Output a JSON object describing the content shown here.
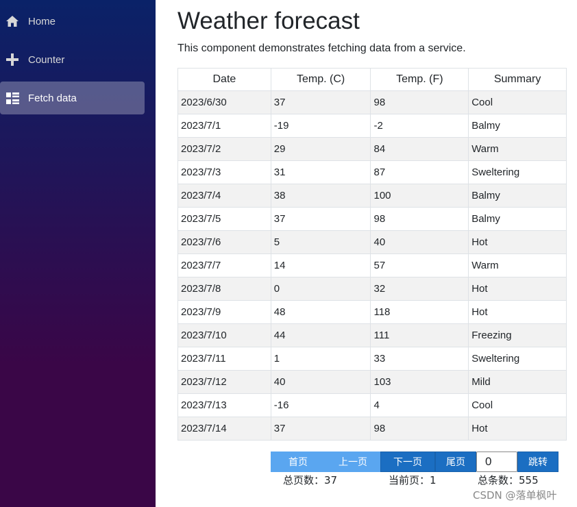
{
  "sidebar": {
    "items": [
      {
        "label": "Home",
        "icon": "home-icon",
        "active": false
      },
      {
        "label": "Counter",
        "icon": "plus-icon",
        "active": false
      },
      {
        "label": "Fetch data",
        "icon": "list-rich-icon",
        "active": true
      }
    ],
    "gradient": {
      "top": "#0a2268",
      "bottom": "#3a0647"
    }
  },
  "page": {
    "title": "Weather forecast",
    "subtitle": "This component demonstrates fetching data from a service."
  },
  "table": {
    "headers": [
      "Date",
      "Temp. (C)",
      "Temp. (F)",
      "Summary"
    ],
    "rows": [
      [
        "2023/6/30",
        "37",
        "98",
        "Cool"
      ],
      [
        "2023/7/1",
        "-19",
        "-2",
        "Balmy"
      ],
      [
        "2023/7/2",
        "29",
        "84",
        "Warm"
      ],
      [
        "2023/7/3",
        "31",
        "87",
        "Sweltering"
      ],
      [
        "2023/7/4",
        "38",
        "100",
        "Balmy"
      ],
      [
        "2023/7/5",
        "37",
        "98",
        "Balmy"
      ],
      [
        "2023/7/6",
        "5",
        "40",
        "Hot"
      ],
      [
        "2023/7/7",
        "14",
        "57",
        "Warm"
      ],
      [
        "2023/7/8",
        "0",
        "32",
        "Hot"
      ],
      [
        "2023/7/9",
        "48",
        "118",
        "Hot"
      ],
      [
        "2023/7/10",
        "44",
        "111",
        "Freezing"
      ],
      [
        "2023/7/11",
        "1",
        "33",
        "Sweltering"
      ],
      [
        "2023/7/12",
        "40",
        "103",
        "Mild"
      ],
      [
        "2023/7/13",
        "-16",
        "4",
        "Cool"
      ],
      [
        "2023/7/14",
        "37",
        "98",
        "Hot"
      ]
    ]
  },
  "pager": {
    "first_label": "首页",
    "prev_label": "上一页",
    "next_label": "下一页",
    "last_label": "尾页",
    "jump_value": "0",
    "jump_label": "跳转",
    "total_pages_text": "总页数：37",
    "current_page_text": "当前页：1",
    "total_items_text": "总条数：555"
  },
  "watermark": "CSDN @落单枫叶"
}
